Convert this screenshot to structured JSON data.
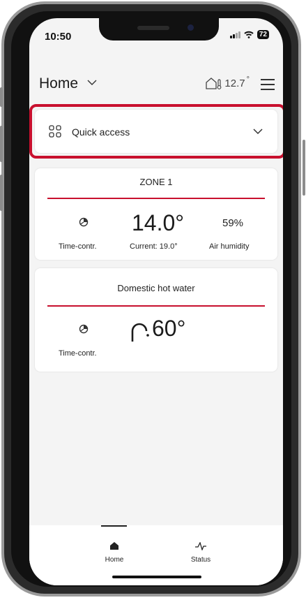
{
  "status_bar": {
    "time": "10:50",
    "battery": "72"
  },
  "header": {
    "title": "Home",
    "outdoor_temp": "12.7",
    "degree_sign": "°"
  },
  "quick_access": {
    "label": "Quick access"
  },
  "zone1": {
    "title": "ZONE 1",
    "mode_label": "Time-contr.",
    "setpoint": "14.0°",
    "current_label": "Current: 19.0°",
    "humidity": "59%",
    "humidity_label": "Air humidity"
  },
  "hot_water": {
    "title": "Domestic hot water",
    "mode_label": "Time-contr.",
    "setpoint": "60°"
  },
  "bottom_nav": {
    "home_label": "Home",
    "status_label": "Status"
  },
  "colors": {
    "accent": "#c8102e",
    "background": "#f4f4f4"
  }
}
